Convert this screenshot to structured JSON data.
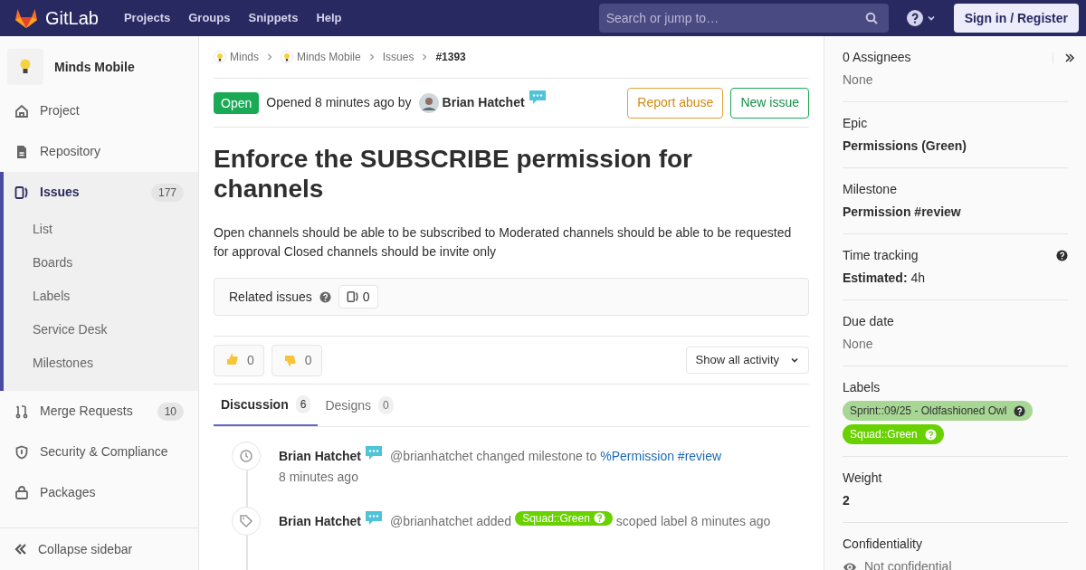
{
  "header": {
    "logo": "GitLab",
    "nav": [
      "Projects",
      "Groups",
      "Snippets",
      "Help"
    ],
    "search": {
      "placeholder": "Search or jump to…"
    },
    "sign_in": "Sign in / Register"
  },
  "sidebar": {
    "project": "Minds Mobile",
    "items": [
      {
        "label": "Project",
        "selected": false
      },
      {
        "label": "Repository",
        "selected": false
      },
      {
        "label": "Issues",
        "count": "177",
        "selected": true,
        "children": [
          {
            "label": "List"
          },
          {
            "label": "Boards"
          },
          {
            "label": "Labels"
          },
          {
            "label": "Service Desk"
          },
          {
            "label": "Milestones"
          }
        ]
      },
      {
        "label": "Merge Requests",
        "count": "10",
        "selected": false
      },
      {
        "label": "Security & Compliance",
        "selected": false
      },
      {
        "label": "Packages",
        "selected": false
      }
    ],
    "collapse": "Collapse sidebar"
  },
  "breadcrumbs": [
    {
      "label": "Minds",
      "kind": "avatar"
    },
    {
      "label": "Minds Mobile",
      "kind": "avatar"
    },
    {
      "label": "Issues",
      "kind": "plain"
    },
    {
      "label": "#1393",
      "kind": "current"
    }
  ],
  "issue": {
    "status": "Open",
    "opened": "Opened 8 minutes ago by",
    "author": "Brian Hatchet",
    "buttons": [
      {
        "label": "Report abuse",
        "kind": "warning"
      },
      {
        "label": "New issue",
        "kind": "success"
      }
    ],
    "title": "Enforce the SUBSCRIBE permission for channels",
    "description": "Open channels should be able to be subscribed to Moderated channels should be able to be requested for approval Closed channels should be invite only",
    "related": {
      "label": "Related issues",
      "count": "0"
    },
    "reactions": [
      {
        "kind": "thumbsup",
        "count": "0"
      },
      {
        "kind": "thumbsdown",
        "count": "0"
      }
    ],
    "activity_filter": "Show all activity",
    "tabs": [
      {
        "label": "Discussion",
        "count": "6",
        "selected": true
      },
      {
        "label": "Designs",
        "count": "0",
        "selected": false
      }
    ],
    "timeline": [
      {
        "kind": "milestone",
        "author": "Brian Hatchet",
        "text": "@brianhatchet changed milestone to",
        "link": "%Permission #review",
        "time": "8 minutes ago"
      },
      {
        "kind": "label",
        "author": "Brian Hatchet",
        "text": "@brianhatchet added",
        "label": {
          "text": "Squad::Green",
          "color": "#69d100"
        },
        "after": "scoped label 8 minutes ago"
      }
    ]
  },
  "right_sidebar": {
    "sections": [
      {
        "kind": "assignees",
        "title": "0 Assignees",
        "value": "None"
      },
      {
        "kind": "bold",
        "title": "Epic",
        "value": "Permissions (Green)"
      },
      {
        "kind": "bold",
        "title": "Milestone",
        "value": "Permission #review"
      },
      {
        "kind": "time",
        "title": "Time tracking",
        "key": "Estimated:",
        "value": "4h"
      },
      {
        "kind": "muted",
        "title": "Due date",
        "value": "None"
      },
      {
        "kind": "labels",
        "title": "Labels",
        "labels": [
          {
            "text": "Sprint::09/25 - Oldfashioned Owl",
            "color": "#a8d695"
          },
          {
            "text": "Squad::Green",
            "color": "#69d100"
          }
        ]
      },
      {
        "kind": "bold",
        "title": "Weight",
        "value": "2"
      },
      {
        "kind": "confidential",
        "title": "Confidentiality",
        "value": "Not confidential"
      }
    ]
  }
}
